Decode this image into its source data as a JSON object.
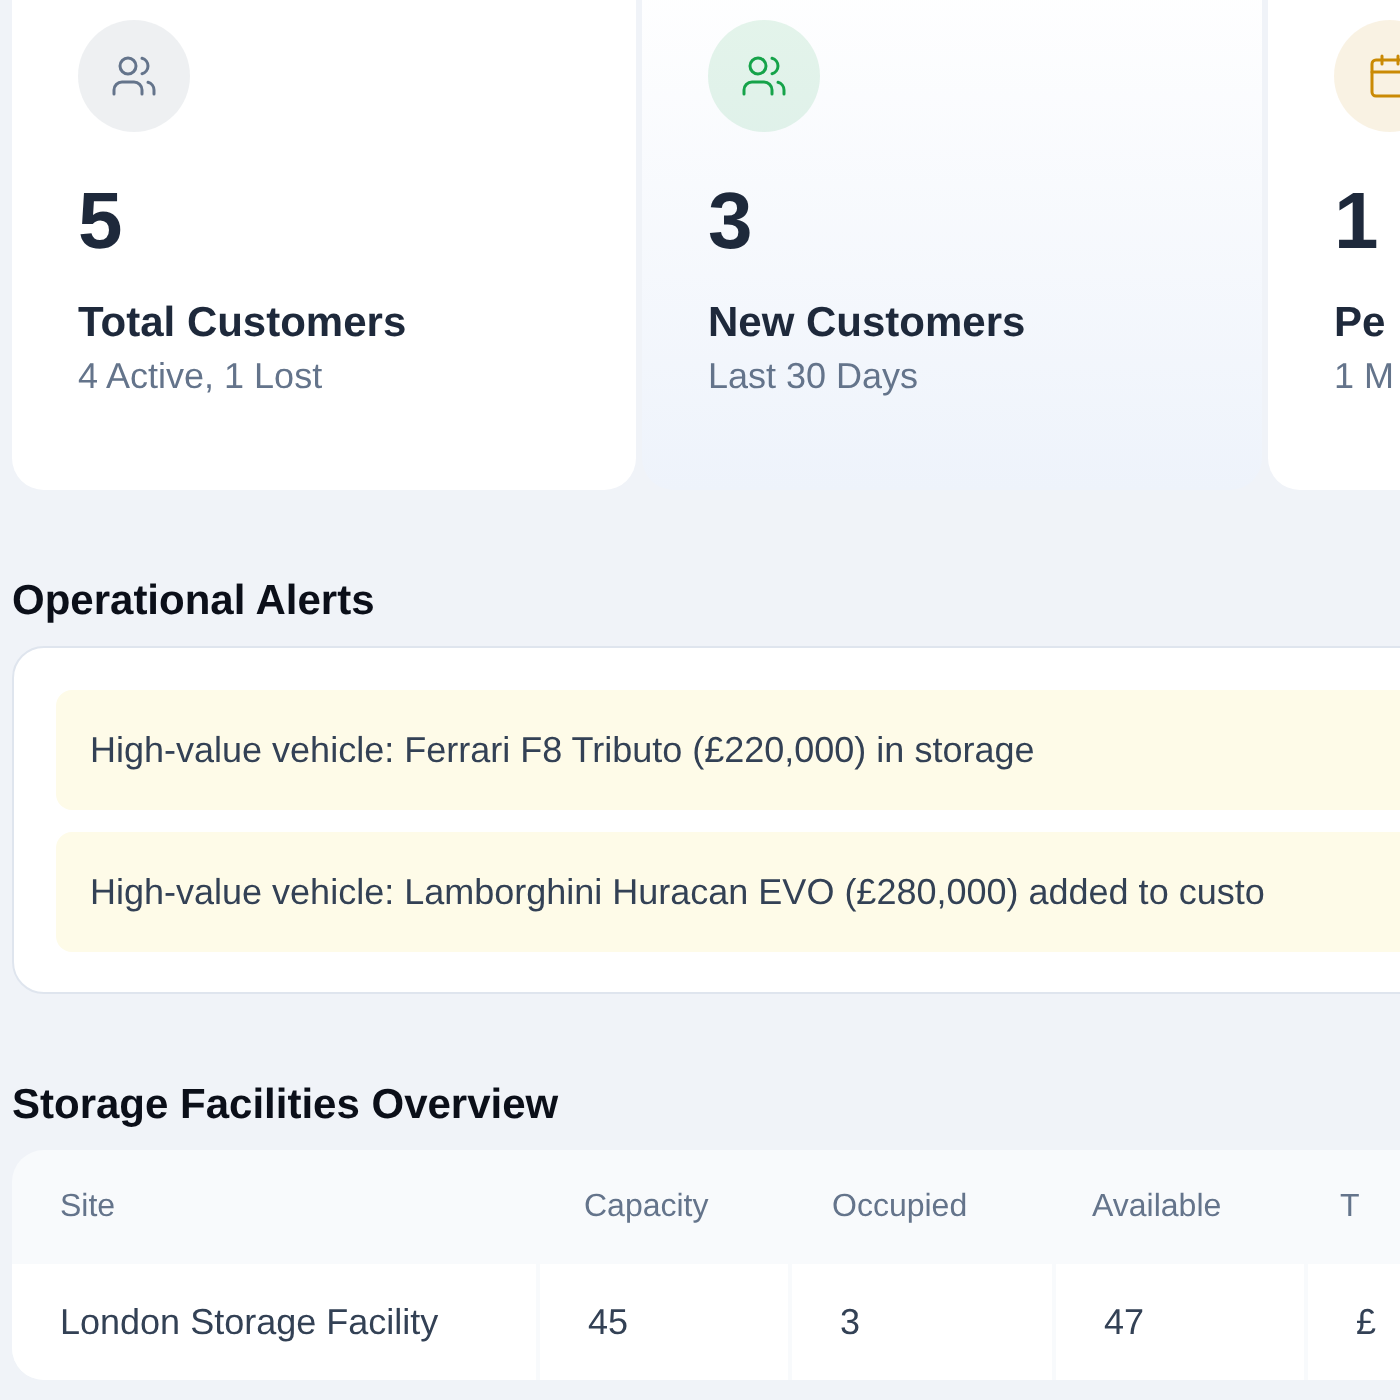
{
  "stat_cards": [
    {
      "kind": "users",
      "color": "#64748b",
      "value": "5",
      "title": "Total Customers",
      "subtitle": "4 Active, 1 Lost",
      "selected": false
    },
    {
      "kind": "users",
      "color": "#16a34a",
      "value": "3",
      "title": "New Customers",
      "subtitle": "Last 30 Days",
      "selected": true
    },
    {
      "kind": "calendar",
      "color": "#ca8a04",
      "value": "1",
      "title": "Pe",
      "subtitle": "1 M",
      "selected": false
    }
  ],
  "alerts": {
    "title": "Operational Alerts",
    "items": [
      "High-value vehicle: Ferrari F8 Tributo (£220,000) in storage",
      "High-value vehicle: Lamborghini Huracan EVO (£280,000) added to custo"
    ]
  },
  "storage": {
    "title": "Storage Facilities Overview",
    "columns": [
      "Site",
      "Capacity",
      "Occupied",
      "Available",
      "T"
    ],
    "rows": [
      [
        "London Storage Facility",
        "45",
        "3",
        "47",
        "£"
      ]
    ]
  }
}
